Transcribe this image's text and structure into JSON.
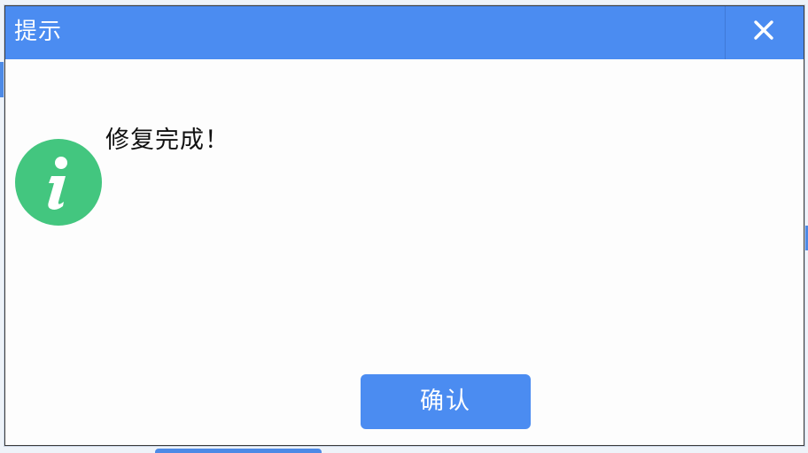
{
  "dialog": {
    "title": "提示",
    "close_icon": "close-icon",
    "info_icon": "info-icon",
    "message": "修复完成！",
    "confirm_label": "确认"
  },
  "colors": {
    "accent": "#4b8cf1",
    "info_green": "#43c67f",
    "text": "#111111",
    "background": "#fdfdfd"
  }
}
